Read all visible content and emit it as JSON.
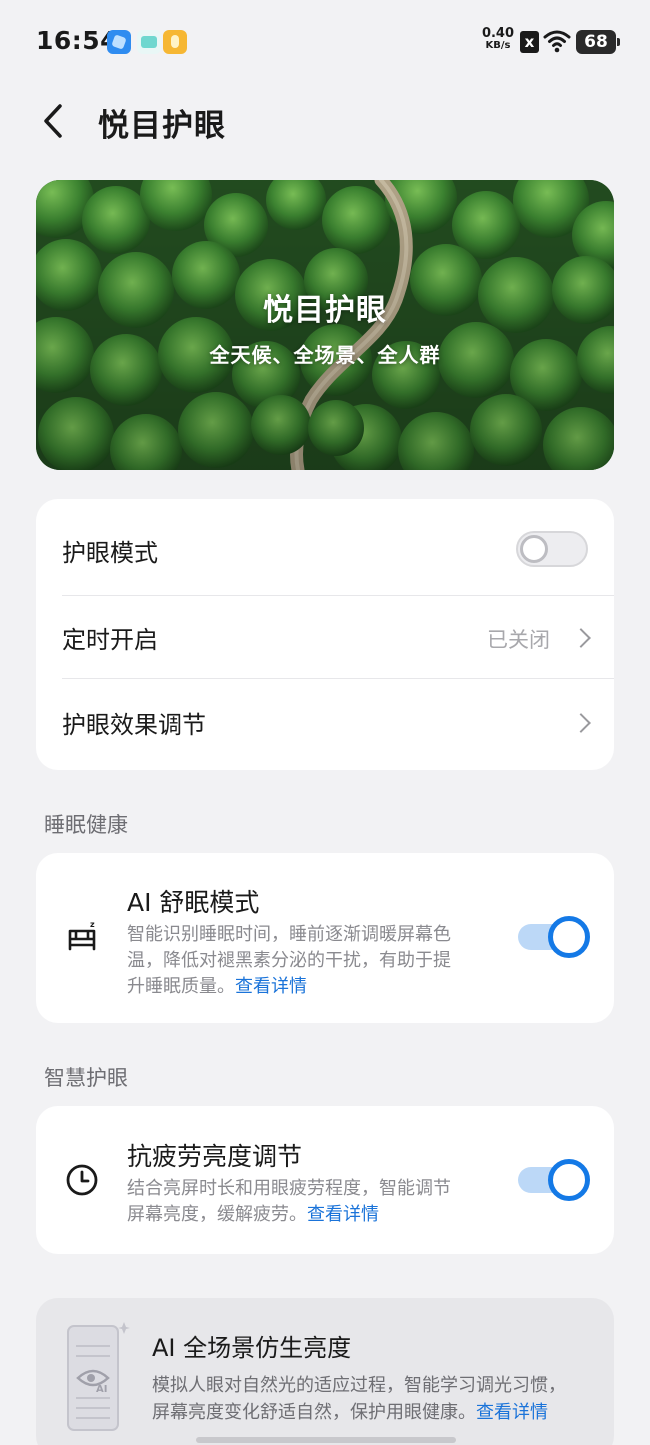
{
  "status_bar": {
    "time": "16:54",
    "net_speed_value": "0.40",
    "net_speed_unit": "KB/s",
    "sim_status": "x",
    "battery": "68"
  },
  "header": {
    "back_icon": "chevron-left-icon",
    "title": "悦目护眼"
  },
  "banner": {
    "title": "悦目护眼",
    "subtitle": "全天候、全场景、全人群"
  },
  "main_settings": {
    "eye_mode_label": "护眼模式",
    "eye_mode_enabled": false,
    "schedule_label": "定时开启",
    "schedule_value": "已关闭",
    "effect_label": "护眼效果调节"
  },
  "sleep_section": {
    "header": "睡眠健康",
    "icon": "bed-icon",
    "title": "AI 舒眠模式",
    "desc_line1": "智能识别睡眠时间，睡前逐渐调暖屏幕色",
    "desc_line2": "温，降低对褪黑素分泌的干扰，有助于提",
    "desc_line3": "升睡眠质量。",
    "link": "查看详情",
    "enabled": true
  },
  "smart_section": {
    "header": "智慧护眼",
    "icon": "clock-icon",
    "title": "抗疲劳亮度调节",
    "desc_line1": "结合亮屏时长和用眼疲劳程度，智能调节",
    "desc_line2": "屏幕亮度，缓解疲劳。",
    "link": "查看详情",
    "enabled": true
  },
  "ai_brightness": {
    "title": "AI 全场景仿生亮度",
    "desc_line1": "模拟人眼对自然光的适应过程，智能学习调光习惯，",
    "desc_line2": "屏幕亮度变化舒适自然，保护用眼健康。",
    "link": "查看详情",
    "illus_text": "AI"
  },
  "colors": {
    "accent": "#1479e6",
    "link": "#1a73d9",
    "background": "#f2f2f4"
  }
}
